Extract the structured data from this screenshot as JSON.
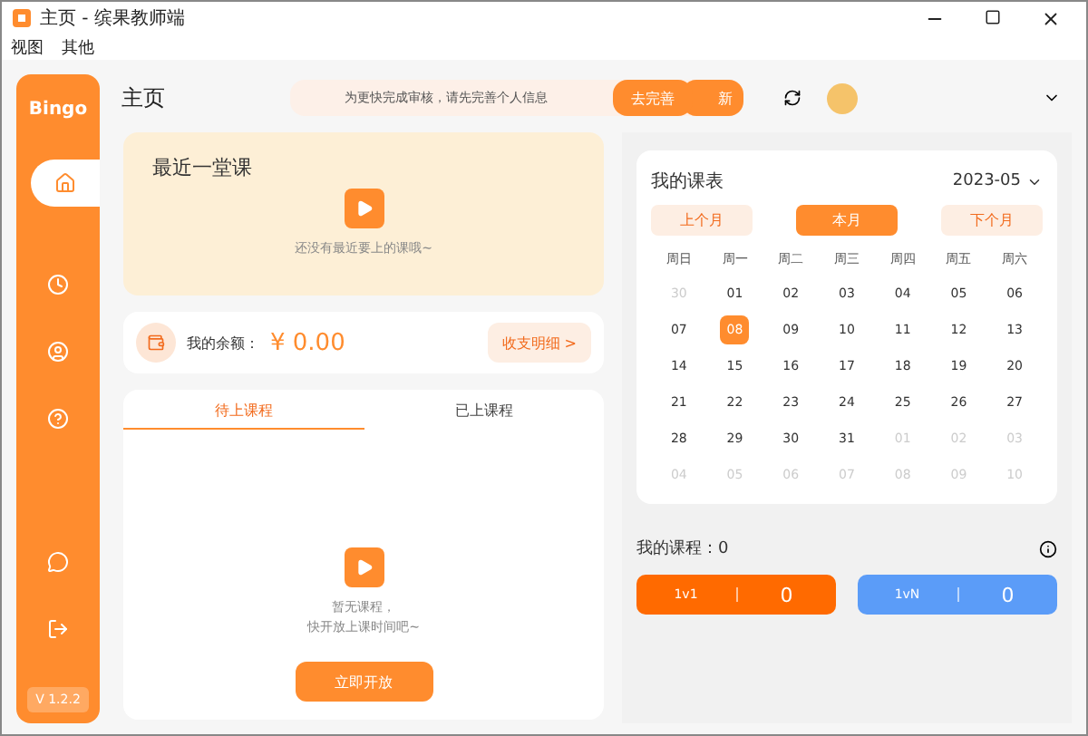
{
  "window": {
    "title": "主页 - 缤果教师端"
  },
  "menu": [
    "视图",
    "其他"
  ],
  "sidebar": {
    "logo": "Bingo",
    "items": [
      {
        "kind": "home",
        "selected": true
      },
      {
        "kind": "clock",
        "selected": false
      },
      {
        "kind": "user",
        "selected": false
      },
      {
        "kind": "help",
        "selected": false
      },
      {
        "kind": "chat",
        "selected": false
      },
      {
        "kind": "logout",
        "selected": false
      }
    ],
    "version": "V 1.2.2"
  },
  "header": {
    "title": "主页",
    "notice": "为更快完成审核，请先完善个人信息",
    "notice_button": "去完善",
    "hidden_button": "新"
  },
  "recent": {
    "title": "最近一堂课",
    "empty": "还没有最近要上的课哦~"
  },
  "balance": {
    "label": "我的余额：",
    "amount": "¥ 0.00",
    "button": "收支明细 >"
  },
  "course_tabs": [
    {
      "label": "待上课程",
      "selected": true
    },
    {
      "label": "已上课程",
      "selected": false
    }
  ],
  "empty_courses": {
    "line_1": "暂无课程，",
    "line_2": "快开放上课时间吧~",
    "button": "立即开放"
  },
  "calendar": {
    "title": "我的课表",
    "month": "2023-05",
    "nav": [
      {
        "label": "上个月",
        "selected": false
      },
      {
        "label": "本月",
        "selected": true
      },
      {
        "label": "下个月",
        "selected": false
      }
    ],
    "weekdays": [
      "周日",
      "周一",
      "周二",
      "周三",
      "周四",
      "周五",
      "周六"
    ],
    "weeks": [
      [
        {
          "day": "30",
          "muted": true,
          "selected": false
        },
        {
          "day": "01",
          "muted": false,
          "selected": false
        },
        {
          "day": "02",
          "muted": false,
          "selected": false
        },
        {
          "day": "03",
          "muted": false,
          "selected": false
        },
        {
          "day": "04",
          "muted": false,
          "selected": false
        },
        {
          "day": "05",
          "muted": false,
          "selected": false
        },
        {
          "day": "06",
          "muted": false,
          "selected": false
        }
      ],
      [
        {
          "day": "07",
          "muted": false,
          "selected": false
        },
        {
          "day": "08",
          "muted": false,
          "selected": true
        },
        {
          "day": "09",
          "muted": false,
          "selected": false
        },
        {
          "day": "10",
          "muted": false,
          "selected": false
        },
        {
          "day": "11",
          "muted": false,
          "selected": false
        },
        {
          "day": "12",
          "muted": false,
          "selected": false
        },
        {
          "day": "13",
          "muted": false,
          "selected": false
        }
      ],
      [
        {
          "day": "14",
          "muted": false,
          "selected": false
        },
        {
          "day": "15",
          "muted": false,
          "selected": false
        },
        {
          "day": "16",
          "muted": false,
          "selected": false
        },
        {
          "day": "17",
          "muted": false,
          "selected": false
        },
        {
          "day": "18",
          "muted": false,
          "selected": false
        },
        {
          "day": "19",
          "muted": false,
          "selected": false
        },
        {
          "day": "20",
          "muted": false,
          "selected": false
        }
      ],
      [
        {
          "day": "21",
          "muted": false,
          "selected": false
        },
        {
          "day": "22",
          "muted": false,
          "selected": false
        },
        {
          "day": "23",
          "muted": false,
          "selected": false
        },
        {
          "day": "24",
          "muted": false,
          "selected": false
        },
        {
          "day": "25",
          "muted": false,
          "selected": false
        },
        {
          "day": "26",
          "muted": false,
          "selected": false
        },
        {
          "day": "27",
          "muted": false,
          "selected": false
        }
      ],
      [
        {
          "day": "28",
          "muted": false,
          "selected": false
        },
        {
          "day": "29",
          "muted": false,
          "selected": false
        },
        {
          "day": "30",
          "muted": false,
          "selected": false
        },
        {
          "day": "31",
          "muted": false,
          "selected": false
        },
        {
          "day": "01",
          "muted": true,
          "selected": false
        },
        {
          "day": "02",
          "muted": true,
          "selected": false
        },
        {
          "day": "03",
          "muted": true,
          "selected": false
        }
      ],
      [
        {
          "day": "04",
          "muted": true,
          "selected": false
        },
        {
          "day": "05",
          "muted": true,
          "selected": false
        },
        {
          "day": "06",
          "muted": true,
          "selected": false
        },
        {
          "day": "07",
          "muted": true,
          "selected": false
        },
        {
          "day": "08",
          "muted": true,
          "selected": false
        },
        {
          "day": "09",
          "muted": true,
          "selected": false
        },
        {
          "day": "10",
          "muted": true,
          "selected": false
        }
      ]
    ]
  },
  "my_courses": {
    "label": "我的课程：0",
    "types": [
      {
        "name": "1v1",
        "count": "0",
        "color": "#ff6a00"
      },
      {
        "name": "1vN",
        "count": "0",
        "color": "#5b9cf8"
      }
    ]
  }
}
